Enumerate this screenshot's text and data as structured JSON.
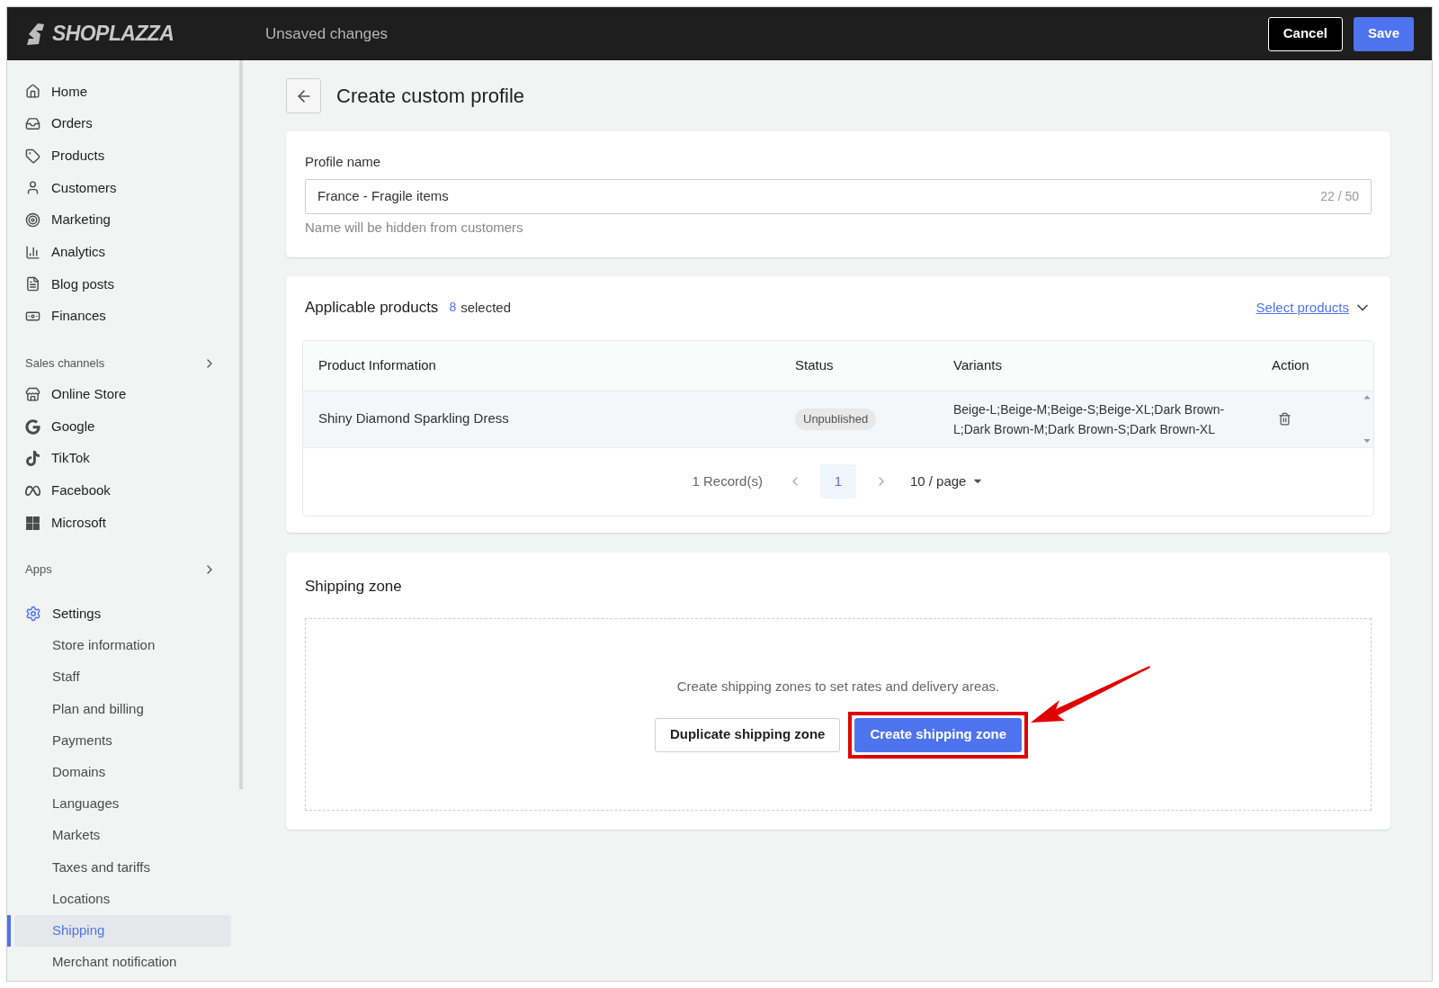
{
  "topbar": {
    "logo": "SHOPLAZZA",
    "title": "Unsaved changes",
    "buttons": [
      {
        "label": "Cancel",
        "kind": "secondary"
      },
      {
        "label": "Save",
        "kind": "primary"
      }
    ]
  },
  "sidebar": {
    "main": [
      {
        "label": "Home"
      },
      {
        "label": "Orders"
      },
      {
        "label": "Products"
      },
      {
        "label": "Customers"
      },
      {
        "label": "Marketing"
      },
      {
        "label": "Analytics"
      },
      {
        "label": "Blog posts"
      },
      {
        "label": "Finances"
      }
    ],
    "sales_channels": {
      "label": "Sales channels",
      "items": [
        {
          "label": "Online Store"
        },
        {
          "label": "Google"
        },
        {
          "label": "TikTok"
        },
        {
          "label": "Facebook"
        },
        {
          "label": "Microsoft"
        }
      ]
    },
    "apps": {
      "label": "Apps"
    },
    "settings": {
      "label": "Settings",
      "expanded": true,
      "children": [
        {
          "label": "Store information",
          "selected": false
        },
        {
          "label": "Staff",
          "selected": false
        },
        {
          "label": "Plan and billing",
          "selected": false
        },
        {
          "label": "Payments",
          "selected": false
        },
        {
          "label": "Domains",
          "selected": false
        },
        {
          "label": "Languages",
          "selected": false
        },
        {
          "label": "Markets",
          "selected": false
        },
        {
          "label": "Taxes and tariffs",
          "selected": false
        },
        {
          "label": "Locations",
          "selected": false
        },
        {
          "label": "Shipping",
          "selected": true
        },
        {
          "label": "Merchant notification",
          "selected": false
        }
      ]
    }
  },
  "page": {
    "title": "Create custom profile"
  },
  "profile": {
    "label": "Profile name",
    "value": "France - Fragile items",
    "counter": "22 / 50",
    "help": "Name will be hidden from customers"
  },
  "products": {
    "title": "Applicable products",
    "count": "8",
    "count_suffix": "selected",
    "link": "Select products",
    "columns": [
      "Product Information",
      "Status",
      "Variants",
      "Action"
    ],
    "rows": [
      {
        "name": "Shiny Diamond Sparkling Dress",
        "status": "Unpublished",
        "variants": "Beige-L;Beige-M;Beige-S;Beige-XL;Dark Brown-L;Dark Brown-M;Dark Brown-S;Dark Brown-XL"
      }
    ],
    "pagination": {
      "records": "1 Record(s)",
      "pages": [
        {
          "label": "1",
          "selected": true
        }
      ],
      "page_size": "10 / page"
    }
  },
  "shipping": {
    "title": "Shipping zone",
    "message": "Create shipping zones to set rates and delivery areas.",
    "buttons": [
      {
        "label": "Duplicate shipping zone",
        "kind": "secondary",
        "highlighted": false
      },
      {
        "label": "Create shipping zone",
        "kind": "primary",
        "highlighted": true
      }
    ]
  }
}
